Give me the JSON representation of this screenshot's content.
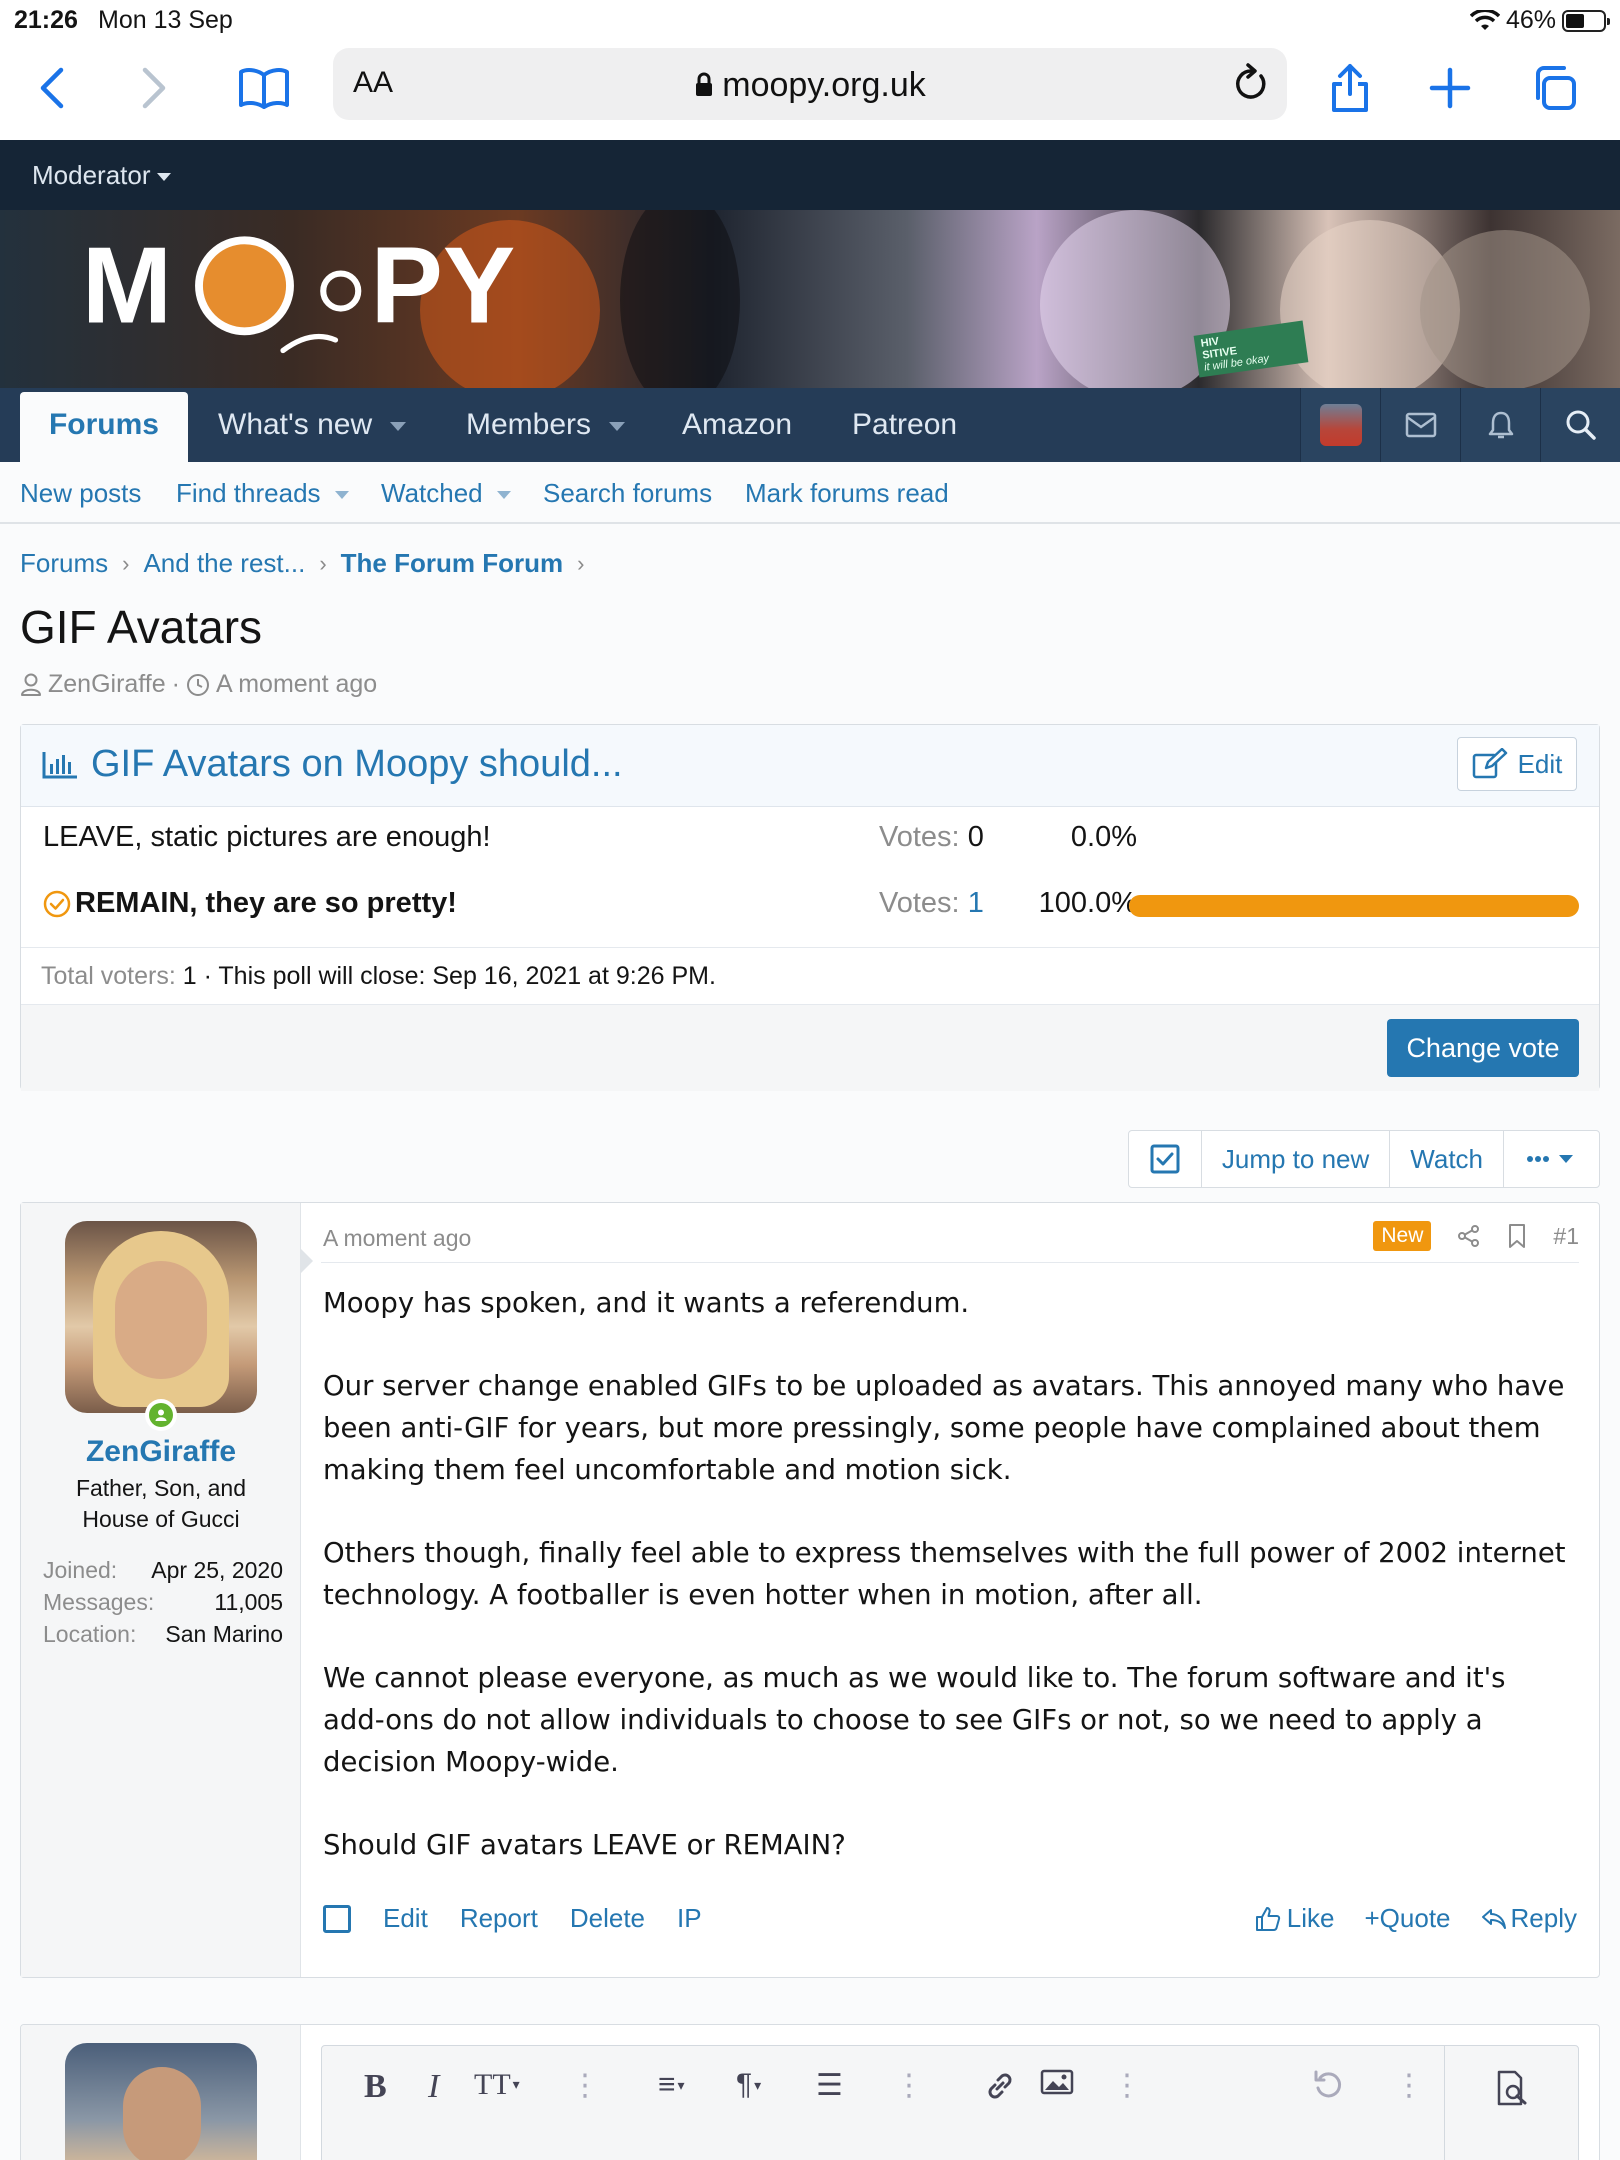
{
  "status_bar": {
    "time": "21:26",
    "date": "Mon 13 Sep",
    "battery": "46%"
  },
  "safari": {
    "text_size_label": "AA",
    "url": "moopy.org.uk"
  },
  "forum": {
    "moderator_label": "Moderator",
    "logo_text": "MOOPY",
    "banner_text": [
      "HIV",
      "SITIVE",
      "it will be okay"
    ],
    "nav_tabs": [
      {
        "label": "Forums"
      },
      {
        "label": "What's new"
      },
      {
        "label": "Members"
      },
      {
        "label": "Amazon"
      },
      {
        "label": "Patreon"
      }
    ],
    "sub_nav": [
      "New posts",
      "Find threads",
      "Watched",
      "Search forums",
      "Mark forums read"
    ],
    "breadcrumbs": [
      "Forums",
      "And the rest...",
      "The Forum Forum"
    ],
    "thread": {
      "title": "GIF Avatars",
      "author": "ZenGiraffe",
      "time": "A moment ago"
    },
    "poll": {
      "title": "GIF Avatars on Moopy should...",
      "edit_label": "Edit",
      "votes_prefix": "Votes:",
      "options": [
        {
          "label": "LEAVE, static pictures are enough!",
          "votes": "0",
          "percent": "0.0%",
          "fraction": 0,
          "voted": false
        },
        {
          "label": "REMAIN, they are so pretty!",
          "votes": "1",
          "percent": "100.0%",
          "fraction": 1,
          "voted": true
        }
      ],
      "total_label": "Total voters:",
      "total": "1",
      "close_text": "· This poll will close: Sep 16, 2021 at 9:26 PM.",
      "change_vote_label": "Change vote",
      "accent_color": "#f0970f"
    },
    "thread_tools": {
      "jump_label": "Jump to new",
      "watch_label": "Watch"
    },
    "post": {
      "username": "ZenGiraffe",
      "user_title": "Father, Son, and House of Gucci",
      "stats": [
        {
          "key": "Joined:",
          "value": "Apr 25, 2020"
        },
        {
          "key": "Messages:",
          "value": "11,005"
        },
        {
          "key": "Location:",
          "value": "San Marino"
        }
      ],
      "time": "A moment ago",
      "new_badge": "New",
      "number": "#1",
      "paragraphs": [
        "Moopy has spoken, and it wants a referendum.",
        "Our server change enabled GIFs to be uploaded as avatars. This annoyed many who have been anti-GIF for years, but more pressingly, some people have complained about them making them feel uncomfortable and motion sick.",
        "Others though, finally feel able to express themselves with the full power of 2002 internet technology. A footballer is even hotter when in motion, after all.",
        "We cannot please everyone, as much as we would like to. The forum software and it's add-ons do not allow individuals to choose to see GIFs or not, so we need to apply a decision Moopy-wide.",
        "Should GIF avatars LEAVE or REMAIN?"
      ],
      "actions_left": [
        "Edit",
        "Report",
        "Delete",
        "IP"
      ],
      "like_label": "Like",
      "quote_label": "+Quote",
      "reply_label": "Reply"
    },
    "colors": {
      "link": "#2577b1",
      "nav_dark": "#152536",
      "nav": "#253c57"
    }
  }
}
